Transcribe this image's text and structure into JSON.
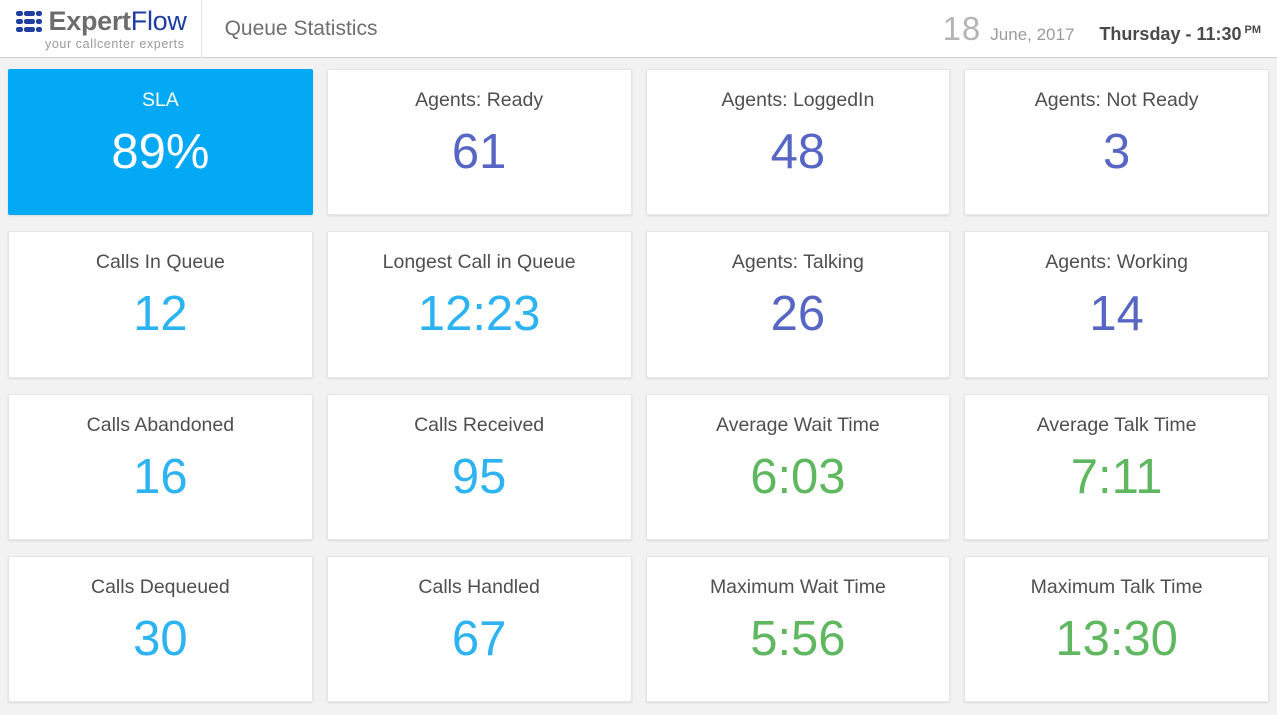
{
  "header": {
    "logo": {
      "icon": "expertflow-grid-icon",
      "word_primary": "Expert",
      "word_secondary": "Flow",
      "tagline": "your callcenter experts",
      "primary_color": "#6d6d6d",
      "secondary_color": "#1f3fa0"
    },
    "page_title": "Queue Statistics",
    "date": {
      "day": "18",
      "month_year": "June, 2017",
      "weekday_time": "Thursday - 11:30",
      "meridiem": "PM"
    }
  },
  "colors": {
    "accent_tile_bg": "#03a9f4",
    "value_purple": "#5766c4",
    "value_cyan": "#2eb3f2",
    "value_green": "#5fb75f",
    "page_bg": "#f2f2f2",
    "card_bg": "#ffffff",
    "label_text": "#4f4f4f"
  },
  "tiles": [
    {
      "label": "SLA",
      "value": "89%",
      "style": "accent"
    },
    {
      "label": "Agents: Ready",
      "value": "61",
      "style": "purple"
    },
    {
      "label": "Agents: LoggedIn",
      "value": "48",
      "style": "purple"
    },
    {
      "label": "Agents: Not Ready",
      "value": "3",
      "style": "purple"
    },
    {
      "label": "Calls In Queue",
      "value": "12",
      "style": "cyan"
    },
    {
      "label": "Longest Call in Queue",
      "value": "12:23",
      "style": "cyan"
    },
    {
      "label": "Agents: Talking",
      "value": "26",
      "style": "purple"
    },
    {
      "label": "Agents: Working",
      "value": "14",
      "style": "purple"
    },
    {
      "label": "Calls Abandoned",
      "value": "16",
      "style": "cyan"
    },
    {
      "label": "Calls Received",
      "value": "95",
      "style": "cyan"
    },
    {
      "label": "Average Wait Time",
      "value": "6:03",
      "style": "green"
    },
    {
      "label": "Average Talk Time",
      "value": "7:11",
      "style": "green"
    },
    {
      "label": "Calls Dequeued",
      "value": "30",
      "style": "cyan"
    },
    {
      "label": "Calls Handled",
      "value": "67",
      "style": "cyan"
    },
    {
      "label": "Maximum Wait Time",
      "value": "5:56",
      "style": "green"
    },
    {
      "label": "Maximum Talk Time",
      "value": "13:30",
      "style": "green"
    }
  ]
}
